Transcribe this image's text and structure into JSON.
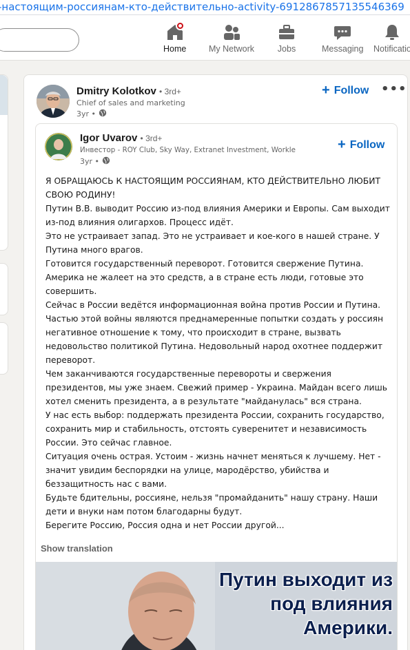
{
  "browser": {
    "url_fragment": "-настоящим-россиянам-кто-действительно-activity-6912867857135546369"
  },
  "nav": {
    "items": [
      {
        "label": "Home",
        "icon": "home-icon"
      },
      {
        "label": "My Network",
        "icon": "network-icon"
      },
      {
        "label": "Jobs",
        "icon": "briefcase-icon"
      },
      {
        "label": "Messaging",
        "icon": "messaging-icon"
      },
      {
        "label": "Notifications",
        "icon": "bell-icon"
      }
    ],
    "visible_labels": [
      "Home",
      "My Network",
      "Jobs",
      "Messaging",
      "Notificatio"
    ]
  },
  "post": {
    "author": {
      "name": "Dmitry Kolotkov",
      "degree": "• 3rd+",
      "headline": "Chief of sales and marketing",
      "time": "3yr •"
    },
    "follow_label": "Follow",
    "more_label": "•••",
    "shared": {
      "author": {
        "name": "Igor Uvarov",
        "degree": "• 3rd+",
        "headline": "Инвестор - ROY Club, Sky Way, Extranet Investment, Workle",
        "time": "3yr •"
      },
      "follow_label": "Follow",
      "paragraphs": [
        "Я ОБРАЩАЮСЬ К НАСТОЯЩИМ РОССИЯНАМ, КТО ДЕЙСТВИТЕЛЬНО ЛЮБИТ СВОЮ РОДИНУ!",
        "Путин В.В. выводит Россию из-под влияния Америки и Европы. Сам выходит из-под влияния олигархов. Процесс идёт.",
        "Это не устраивает запад. Это не устраивает и кое-кого в нашей стране. У Путина много врагов.",
        "Готовится государственный переворот. Готовится свержение Путина. Америка не жалеет на это средств, а в стране есть люди, готовые это совершить.",
        "Сейчас в России ведётся информационная война против России и Путина. Частью этой войны являются преднамеренные попытки создать у россиян негативное отношение к тому, что происходит в стране, вызвать недовольство политикой Путина. Недовольный народ охотнее поддержит переворот.",
        "Чем заканчиваются государственные перевороты и свержения президентов, мы уже знаем. Свежий пример - Украина. Майдан всего лишь хотел сменить президента, а в результате \"майданулась\" вся страна.",
        "У нас есть выбор: поддержать президента России, сохранить государство, сохранить мир и стабильность, отстоять суверенитет и независимость России. Это сейчас главное.",
        "Ситуация очень острая. Устоим - жизнь начнет меняться к лучшему. Нет - значит увидим беспорядки на улице, мародёрство, убийства и беззащитность нас с вами.",
        "Будьте бдительны, россияне, нельзя \"промайданить\" нашу страну. Наши дети и внуки нам потом благодарны будут.",
        "Берегите Россию, Россия одна и нет России другой..."
      ],
      "show_translation": "Show translation",
      "image_caption": [
        "Путин выходит из",
        "под влияния",
        "Америки."
      ]
    }
  },
  "colors": {
    "brand_blue": "#0a66c2",
    "notification_red": "#cc1016",
    "caption_navy": "#0b1f4d"
  }
}
